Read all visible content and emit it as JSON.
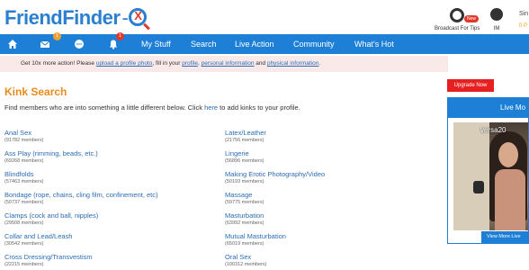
{
  "header": {
    "logo_friend": "Friend",
    "logo_finder": "Finder",
    "logo_dash": "-",
    "logo_x": "X",
    "broadcast_label": "Broadcast For Tips",
    "broadcast_badge": "New",
    "im_label": "IM",
    "user_name_partial": "Sin",
    "points_partial": "0 P"
  },
  "nav": {
    "messages_badge": "1",
    "notifications_badge": "1",
    "items": [
      "My Stuff",
      "Search",
      "Live Action",
      "Community",
      "What's Hot"
    ],
    "icons": [
      "home-icon",
      "mail-icon",
      "chat-icon",
      "bell-icon"
    ]
  },
  "notice": {
    "prefix": "Get 10x more action! Please ",
    "link1": "upload a profile photo",
    "mid1": ", fill in your ",
    "link2": "profile",
    "mid2": ", ",
    "link3": "personal information",
    "mid3": " and ",
    "link4": "physical information",
    "suffix": "."
  },
  "upgrade_label": "Upgrade Now",
  "page_title": "Kink Search",
  "intro": {
    "prefix": "Find members who are into something a little different below. Click ",
    "link": "here",
    "suffix": " to add kinks to your profile."
  },
  "kinks_left": [
    {
      "name": "Anal Sex",
      "count": "(91782 members)"
    },
    {
      "name": "Ass Play (rimming, beads, etc.)",
      "count": "(69268 members)"
    },
    {
      "name": "Blindfolds",
      "count": "(57463 members)"
    },
    {
      "name": "Bondage (rope, chains, cling film, confinement, etc)",
      "count": "(50737 members)"
    },
    {
      "name": "Clamps (cock and ball, nipples)",
      "count": "(29508 members)"
    },
    {
      "name": "Collar and Lead/Leash",
      "count": "(30542 members)"
    },
    {
      "name": "Cross Dressing/Transvestism",
      "count": "(22215 members)"
    }
  ],
  "kinks_right": [
    {
      "name": "Latex/Leather",
      "count": "(21756 members)"
    },
    {
      "name": "Lingerie",
      "count": "(56896 members)"
    },
    {
      "name": "Making Erotic Photography/Video",
      "count": "(50193 members)"
    },
    {
      "name": "Massage",
      "count": "(59775 members)"
    },
    {
      "name": "Masturbation",
      "count": "(63992 members)"
    },
    {
      "name": "Mutual Masturbation",
      "count": "(65019 members)"
    },
    {
      "name": "Oral Sex",
      "count": "(100312 members)"
    }
  ],
  "live": {
    "title_partial": "Live Mo",
    "username_partial": "versa20",
    "view_more_partial": "View More Live"
  },
  "colors": {
    "brand_blue": "#1e7fd6",
    "title_orange": "#e98b1c",
    "link_blue": "#2a6db5",
    "upgrade_red": "#e62020"
  }
}
